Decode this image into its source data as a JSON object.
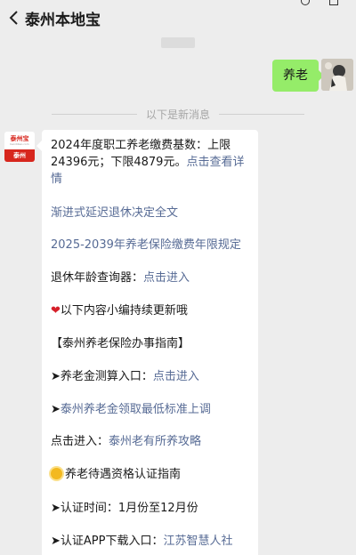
{
  "header": {
    "title": "泰州本地宝"
  },
  "outgoing": {
    "text": "养老"
  },
  "divider": {
    "text": "以下是新消息"
  },
  "account": {
    "logo_top": "泰州宝",
    "logo_sub": "bendibao.com",
    "logo_city": "泰州"
  },
  "message": {
    "p1_text": "2024年度职工养老缴费基数：上限24396元；下限4879元。",
    "p1_link": "点击查看详情",
    "p2_link": "渐进式延迟退休决定全文",
    "p3_link": "2025-2039年养老保险缴费年限规定",
    "p4_text": "退休年龄查询器：",
    "p4_link": "点击进入",
    "p5_text": "以下内容小编持续更新哦",
    "p6_text": "【泰州养老保险办事指南】",
    "p7_text": "➤养老金测算入口：",
    "p7_link": "点击进入",
    "p8_arrow": "➤",
    "p8_link": "泰州养老金领取最低标准上调",
    "p9_text": "点击进入：",
    "p9_link": "泰州老有所养攻略",
    "p10_text": "养老待遇资格认证指南",
    "p11_text": "➤认证时间：1月份至12月份",
    "p12_text": "➤认证APP下载入口：",
    "p12_link": "江苏智慧人社"
  }
}
